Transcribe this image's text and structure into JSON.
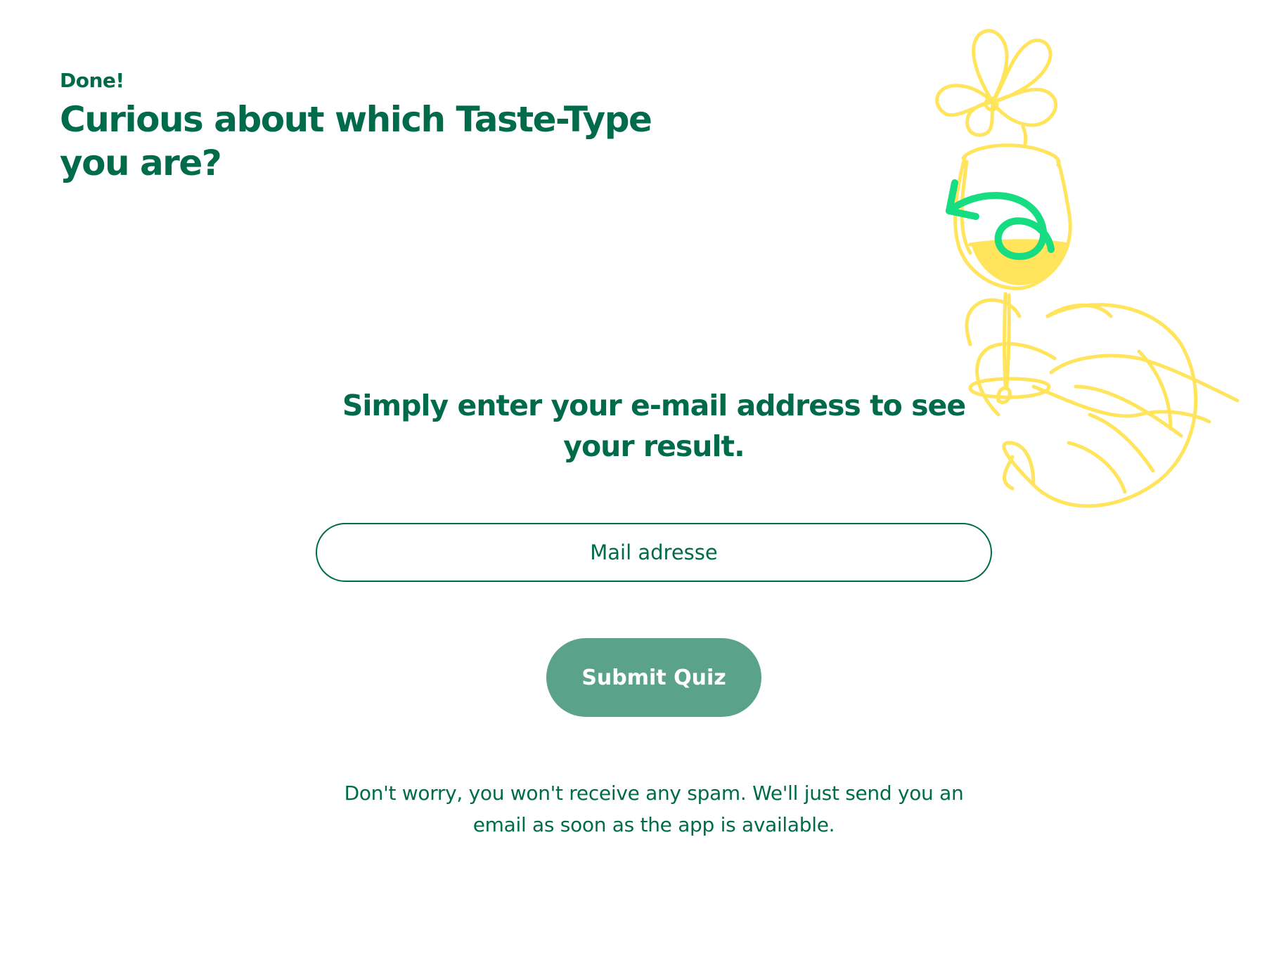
{
  "header": {
    "eyebrow": "Done!",
    "title": "Curious about which Taste-Type you are?"
  },
  "form": {
    "heading": "Simply enter your e-mail address to see your result.",
    "email_placeholder": "Mail adresse",
    "email_value": "",
    "submit_label": "Submit Quiz",
    "disclaimer": "Don't worry, you won't receive any spam. We'll just send you an email as soon as the app is available."
  },
  "illustration": {
    "items": [
      "flower-icon",
      "wine-glass-icon",
      "curly-arrow-icon",
      "shrimp-icon"
    ]
  },
  "colors": {
    "primary_text": "#006b4a",
    "button_bg": "#5ba28b",
    "illustration_yellow": "#ffe45c",
    "arrow_green": "#16dd82",
    "background": "#ffffff"
  }
}
